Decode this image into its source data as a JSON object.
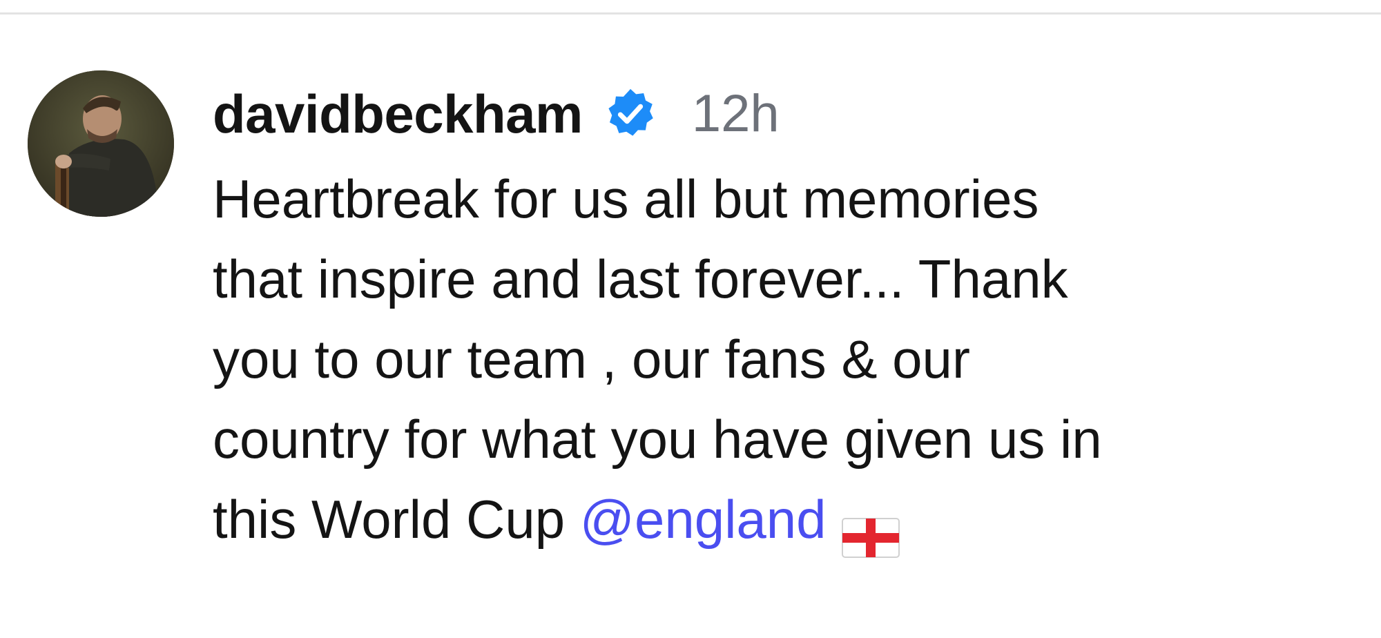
{
  "post": {
    "username": "davidbeckham",
    "timestamp": "12h",
    "verified_icon": "verified-badge-icon",
    "caption_lines": [
      "Heartbreak for us all but memories",
      "that inspire and last forever... Thank",
      "you to our team , our fans & our",
      "country for what you have given us in",
      "this World Cup "
    ],
    "mention": "@england",
    "flag_icon": "england-flag-icon"
  },
  "colors": {
    "verified_blue": "#1d8cf8",
    "mention_blue": "#4a4ef0",
    "timestamp_gray": "#6d7179",
    "text": "#141414",
    "divider": "#e3e3e3"
  }
}
